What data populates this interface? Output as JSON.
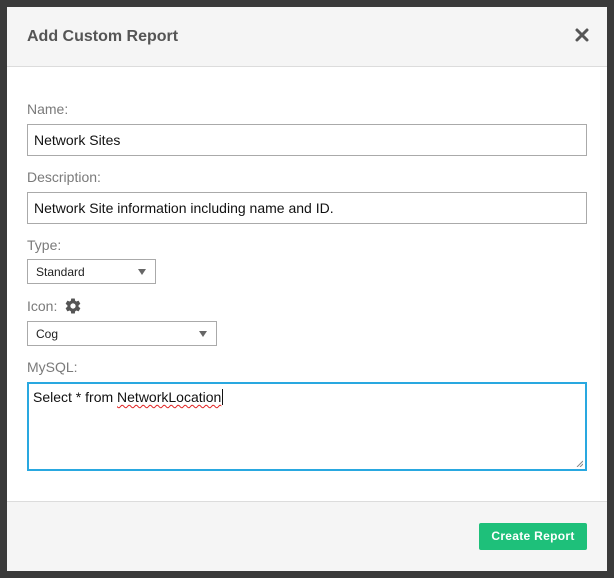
{
  "dialog": {
    "title": "Add Custom Report"
  },
  "form": {
    "name_label": "Name:",
    "name_value": "Network Sites",
    "description_label": "Description:",
    "description_value": "Network Site information including name and ID.",
    "type_label": "Type:",
    "type_value": "Standard",
    "icon_label": "Icon:",
    "icon_value": "Cog",
    "mysql_label": "MySQL:",
    "mysql_prefix": "Select * from ",
    "mysql_table": "NetworkLocation"
  },
  "footer": {
    "create_label": "Create Report"
  },
  "icons": {
    "close": "close-icon",
    "icon_preview": "gear-icon",
    "type_dropdown": "chevron-down-icon",
    "icon_dropdown": "chevron-down-icon"
  },
  "colors": {
    "accent_focus": "#29a8e0",
    "primary_button": "#1ec07a",
    "header_bg": "#f5f5f5"
  }
}
